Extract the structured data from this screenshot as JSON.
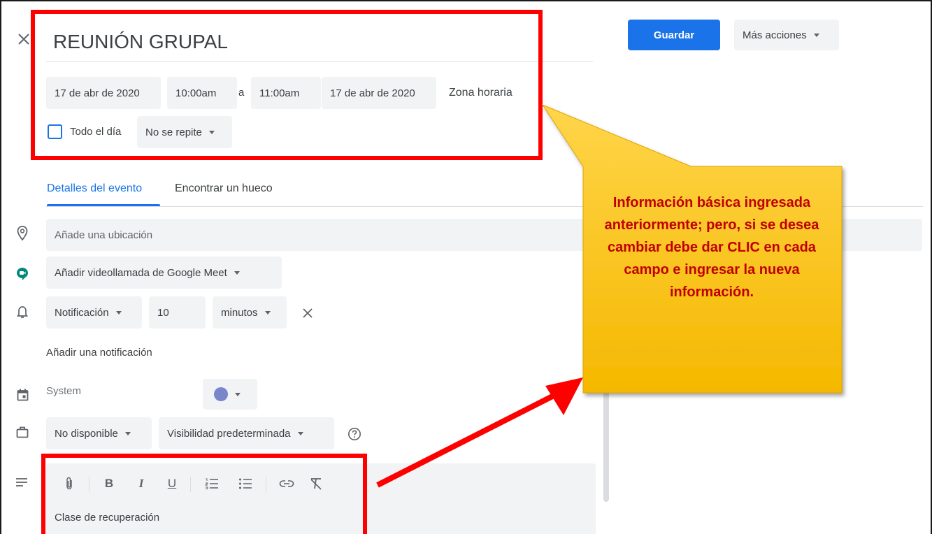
{
  "event": {
    "title": "REUNIÓN GRUPAL",
    "start_date": "17 de abr de 2020",
    "start_time": "10:00am",
    "to_label": "a",
    "end_time": "11:00am",
    "end_date": "17 de abr de 2020",
    "timezone_label": "Zona horaria",
    "all_day_label": "Todo el día",
    "all_day_checked": false,
    "repeat_label": "No se repite"
  },
  "toolbar": {
    "save_label": "Guardar",
    "more_actions_label": "Más acciones"
  },
  "tabs": [
    {
      "label": "Detalles del evento",
      "active": true
    },
    {
      "label": "Encontrar un hueco",
      "active": false
    }
  ],
  "details": {
    "location_placeholder": "Añade una ubicación",
    "meet_label": "Añadir videollamada de Google Meet",
    "notification": {
      "type_label": "Notificación",
      "value": "10",
      "unit_label": "minutos"
    },
    "add_notification_label": "Añadir una notificación",
    "calendar_label": "System",
    "calendar_color": "#7986cb",
    "availability_label": "No disponible",
    "visibility_label": "Visibilidad predeterminada",
    "description_text": "Clase de recuperación"
  },
  "editor_tools": [
    "attach-icon",
    "bold-icon",
    "italic-icon",
    "underline-icon",
    "numbered-list-icon",
    "bulleted-list-icon",
    "link-icon",
    "clear-format-icon"
  ],
  "callout": {
    "text": "Información básica ingresada anteriormente; pero, si se desea cambiar debe dar CLIC en cada campo e ingresar la nueva información."
  },
  "colors": {
    "accent": "#1a73e8",
    "highlight_red": "#ff0000",
    "callout_top": "#ffd54a",
    "callout_bottom": "#f5b800",
    "callout_text": "#c00000",
    "meet_green": "#00897b"
  }
}
